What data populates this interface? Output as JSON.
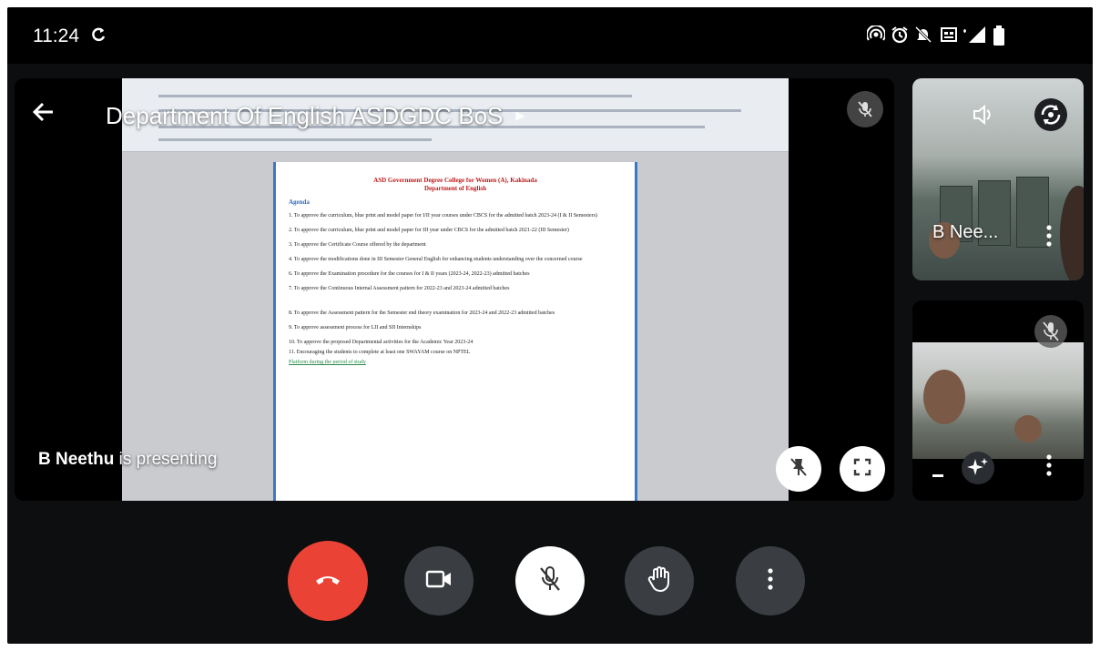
{
  "status_bar": {
    "time": "11:24",
    "left_icons": [
      "sync-icon"
    ],
    "right_icons": [
      "hotspot-icon",
      "alarm-icon",
      "dnd-icon",
      "screen-icon",
      "signal-icon",
      "battery-icon"
    ]
  },
  "meeting": {
    "title": "Department Of English ASDGDC BoS",
    "presenter_name": "B Neethu",
    "presenter_suffix": " is presenting"
  },
  "document": {
    "college_line1": "ASD Government Degree College for Women (A), Kakinada",
    "college_line2": "Department of English",
    "agenda_heading": "Agenda",
    "items": [
      "1. To approve the curriculum, blue print and model paper for I/II year courses under CBCS for the admitted batch 2023-24 (I & II Semesters)",
      "2. To approve the curriculum, blue print and model paper for III year under CBCS for the admitted batch 2021-22 (III Semester)",
      "3. To approve the Certificate Course offered by the department",
      "4. To approve the modifications done in III Semester General English for enhancing students understanding over the concerned course",
      "6. To approve the Examination procedure for the courses for I & II years (2023-24, 2022-23) admitted batches",
      "7. To approve the Continuous Internal Assessment pattern for 2022-23 and 2023-24 admitted batches",
      "8. To approve the Assessment pattern for the Semester end theory examination for 2023-24 and 2022-23 admitted batches",
      "9. To approve assessment process for LII and SII Internships",
      "10. To approve the proposed Departmental activities for the Academic Year 2023-24",
      "11. Encouraging the students to complete at least one SWAYAM course on NPTEL",
      "Platform during the period of study"
    ]
  },
  "participants": [
    {
      "name": "B Nee...",
      "icons": [
        "volume-icon",
        "switch-camera-icon",
        "more-icon"
      ]
    },
    {
      "name": "",
      "icons": [
        "mic-off-icon",
        "effects-icon",
        "more-icon"
      ]
    }
  ],
  "colors": {
    "end_call": "#ea4335",
    "background": "#0d0e10",
    "button": "#3a3d41"
  },
  "controls": [
    "end-call-button",
    "camera-button",
    "mic-button",
    "raise-hand-button",
    "more-options-button"
  ]
}
